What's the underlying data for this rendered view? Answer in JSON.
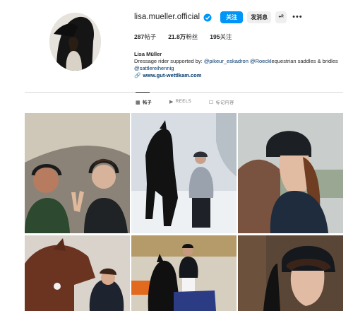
{
  "profile": {
    "username": "lisa.mueller.official",
    "follow_label": "关注",
    "message_label": "发消息",
    "add_user_label": "+ᴿ",
    "more_label": "•••",
    "stats": [
      {
        "value": "287",
        "label": "帖子"
      },
      {
        "value": "21.8万",
        "label": "粉丝"
      },
      {
        "value": "195",
        "label": "关注"
      }
    ],
    "bio": {
      "name": "Lisa Müller",
      "line1_prefix": "Dressage rider ",
      "line1_mid": "supported by: ",
      "mention1": "@pikeur_eskadron",
      "line1_sep": " ",
      "mention2": "@Roeckl",
      "line1_suffix": "equestrian saddles & bridles",
      "mention3": "@sattlereihennig",
      "link_icon": "🔗",
      "link": "www.gut-wettlkam.com"
    }
  },
  "tabs": [
    {
      "icon": "▦",
      "label": "帖子"
    },
    {
      "icon": "▶",
      "label": "REELS"
    },
    {
      "icon": "☐",
      "label": "标记内容"
    }
  ],
  "colors": {
    "accent": "#0095f6",
    "link": "#00376b",
    "verified": "#0095f6"
  }
}
